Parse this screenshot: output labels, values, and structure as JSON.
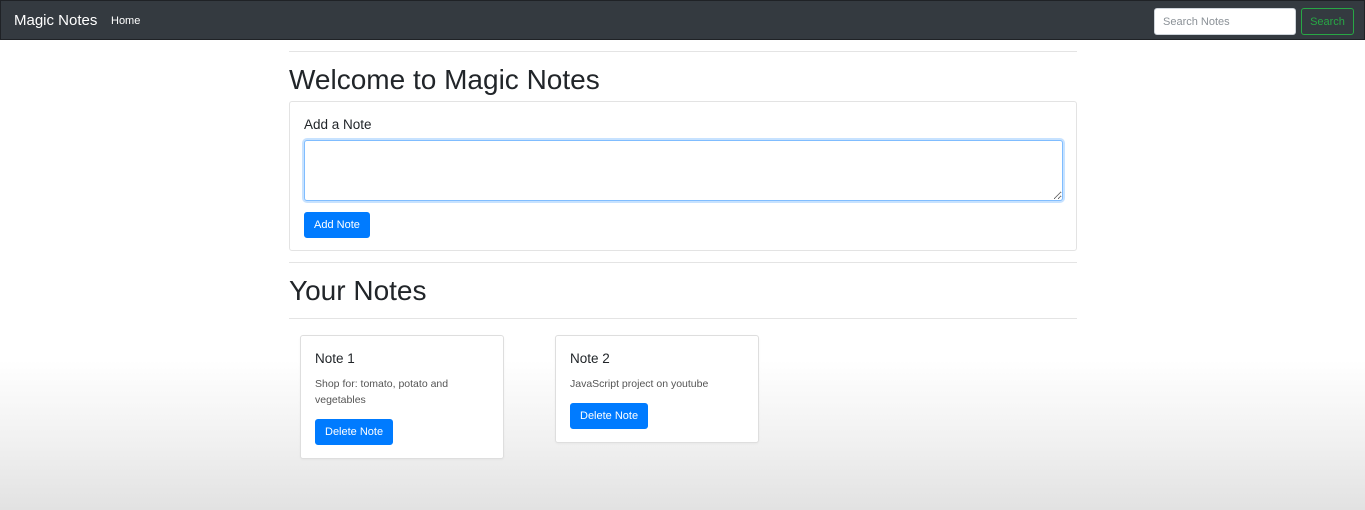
{
  "navbar": {
    "brand": "Magic Notes",
    "home_link": "Home",
    "search": {
      "placeholder": "Search Notes",
      "value": "",
      "button_label": "Search"
    }
  },
  "main": {
    "welcome_heading": "Welcome to Magic Notes",
    "add_note": {
      "label": "Add a Note",
      "textarea_value": "",
      "button_label": "Add Note"
    },
    "notes_heading": "Your Notes",
    "notes": [
      {
        "title": "Note 1",
        "text": "Shop for: tomato, potato and vegetables",
        "delete_label": "Delete Note"
      },
      {
        "title": "Note 2",
        "text": "JavaScript project on youtube",
        "delete_label": "Delete Note"
      }
    ]
  },
  "colors": {
    "navbar_bg": "#343a40",
    "primary": "#007bff",
    "success": "#28a745"
  }
}
